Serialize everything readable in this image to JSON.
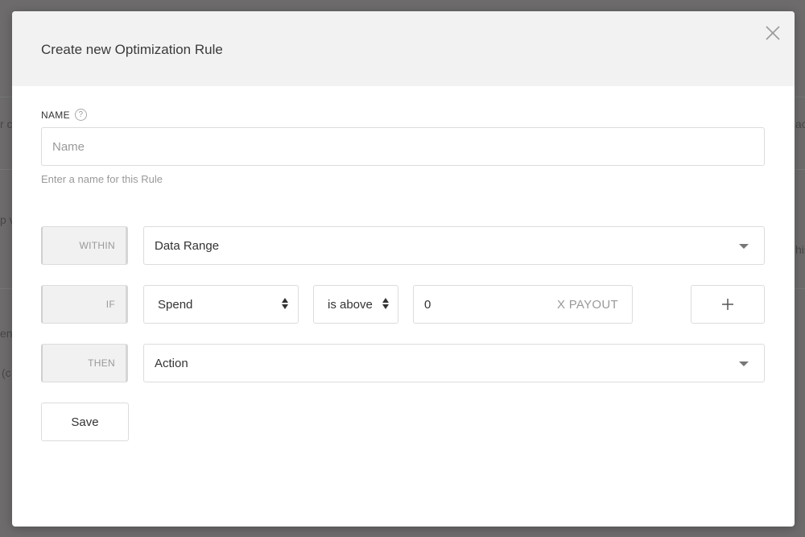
{
  "background": {
    "fragments": [
      "r c",
      "ach",
      "p v",
      "his",
      "en",
      "(c"
    ]
  },
  "modal": {
    "title": "Create new Optimization Rule",
    "close_icon": "close-icon"
  },
  "form": {
    "name_label": "NAME",
    "help_glyph": "?",
    "name_placeholder": "Name",
    "name_value": "",
    "name_hint": "Enter a name for this Rule",
    "within": {
      "tag": "WITHIN",
      "selected": "Data Range"
    },
    "if": {
      "tag": "IF",
      "metric_selected": "Spend",
      "operator_selected": "is above",
      "value": "0",
      "unit": "X PAYOUT",
      "add_icon": "plus-icon"
    },
    "then": {
      "tag": "THEN",
      "selected": "Action"
    },
    "save_label": "Save"
  },
  "colors": {
    "overlay": "#6e6e6e",
    "header_bg": "#f2f2f2",
    "border": "#dcdcdc",
    "muted_text": "#999999"
  }
}
